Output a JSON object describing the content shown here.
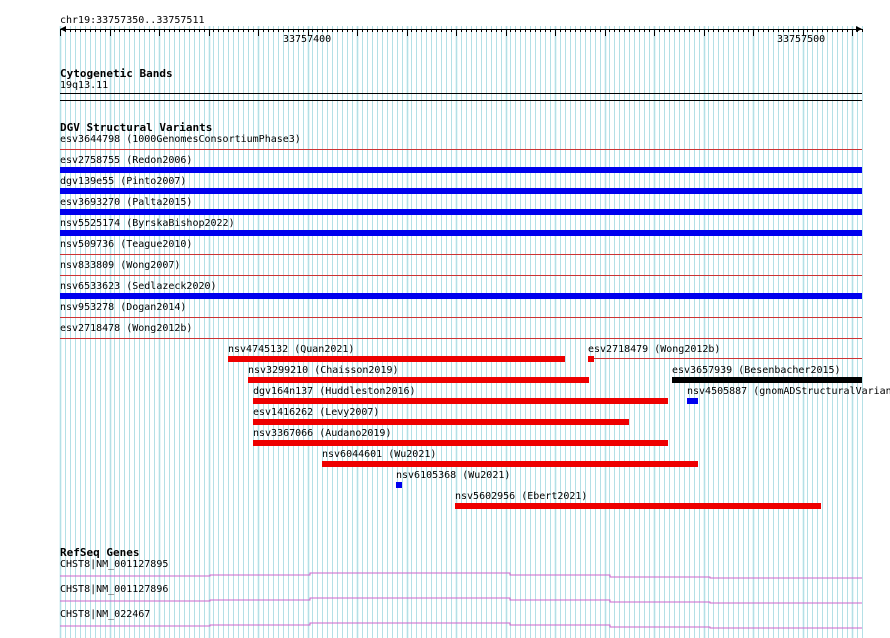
{
  "ruler": {
    "range_label": "chr19:33757350..33757511",
    "tick_labels": [
      "33757400",
      "33757500"
    ]
  },
  "cytoband": {
    "title": "Cytogenetic Bands",
    "band": "19q13.11"
  },
  "dgv": {
    "title": "DGV Structural Variants",
    "rows": [
      {
        "label": "esv3644798 (1000GenomesConsortiumPhase3)",
        "full_bar": false
      },
      {
        "label": "esv2758755 (Redon2006)",
        "full_bar": true
      },
      {
        "label": "dgv139e55 (Pinto2007)",
        "full_bar": true
      },
      {
        "label": "esv3693270 (Palta2015)",
        "full_bar": true
      },
      {
        "label": "nsv5525174 (ByrskaBishop2022)",
        "full_bar": true
      },
      {
        "label": "nsv509736 (Teague2010)",
        "full_bar": false
      },
      {
        "label": "nsv833809 (Wong2007)",
        "full_bar": false
      },
      {
        "label": "nsv6533623 (Sedlazeck2020)",
        "full_bar": true
      },
      {
        "label": "nsv953278 (Dogan2014)",
        "full_bar": false
      },
      {
        "label": "esv2718478 (Wong2012b)",
        "full_bar": false
      }
    ],
    "features": [
      {
        "label": "nsv4745132 (Quan2021)",
        "color": "#ee0000"
      },
      {
        "label": "esv2718479 (Wong2012b)",
        "color": "#ee0000"
      },
      {
        "label": "nsv3299210 (Chaisson2019)",
        "color": "#ee0000"
      },
      {
        "label": "esv3657939 (Besenbacher2015)",
        "color": "#000000"
      },
      {
        "label": "dgv164n137 (Huddleston2016)",
        "color": "#ee0000"
      },
      {
        "label": "nsv4505887 (gnomADStructuralVarian",
        "color": "#0000ee"
      },
      {
        "label": "esv1416262 (Levy2007)",
        "color": "#ee0000"
      },
      {
        "label": "nsv3367066 (Audano2019)",
        "color": "#ee0000"
      },
      {
        "label": "nsv6044601 (Wu2021)",
        "color": "#ee0000"
      },
      {
        "label": "nsv6105368 (Wu2021)",
        "color": "#0000ee"
      },
      {
        "label": "nsv5602956 (Ebert2021)",
        "color": "#ee0000"
      }
    ]
  },
  "refseq": {
    "title": "RefSeq Genes",
    "genes": [
      {
        "label": "CHST8|NM_001127895"
      },
      {
        "label": "CHST8|NM_001127896"
      },
      {
        "label": "CHST8|NM_022467"
      }
    ]
  },
  "colors": {
    "grid": "#b4e0e6",
    "variant_blue": "#0000ee",
    "variant_red": "#ee0000",
    "separator": "#cc3333",
    "gene_line": "#cc66cc"
  }
}
